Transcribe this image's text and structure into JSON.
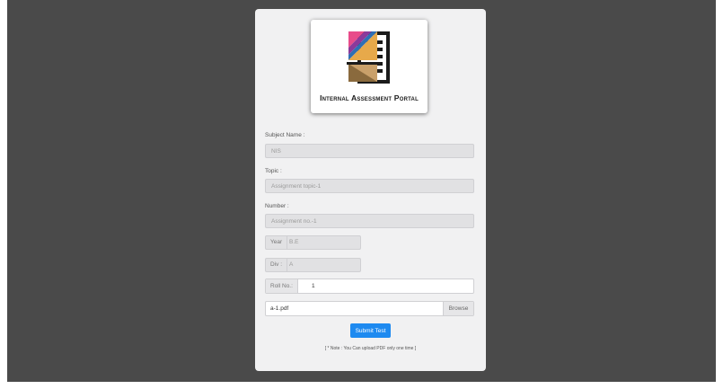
{
  "portal": {
    "title": "Internal Assessment Portal"
  },
  "form": {
    "subject_label": "Subject Name :",
    "subject_value": "NIS",
    "topic_label": "Topic :",
    "topic_value": "Assignment topic-1",
    "number_label": "Number :",
    "number_value": "Assignment no.-1",
    "year_label": "Year",
    "year_value": "B.E",
    "div_label": "Div :",
    "div_value": "A",
    "roll_label": "Roll No.:",
    "roll_value": "1",
    "file_name": "a-1.pdf",
    "browse_label": "Browse",
    "submit_label": "Submit Test",
    "note": "[ * Note : You Can upload PDF only one time ]"
  },
  "colors": {
    "accent": "#1e8af0",
    "backdrop": "#4a4a4a",
    "card": "#f1f1f2"
  },
  "icons": {
    "logo": "document-edit-icon"
  }
}
